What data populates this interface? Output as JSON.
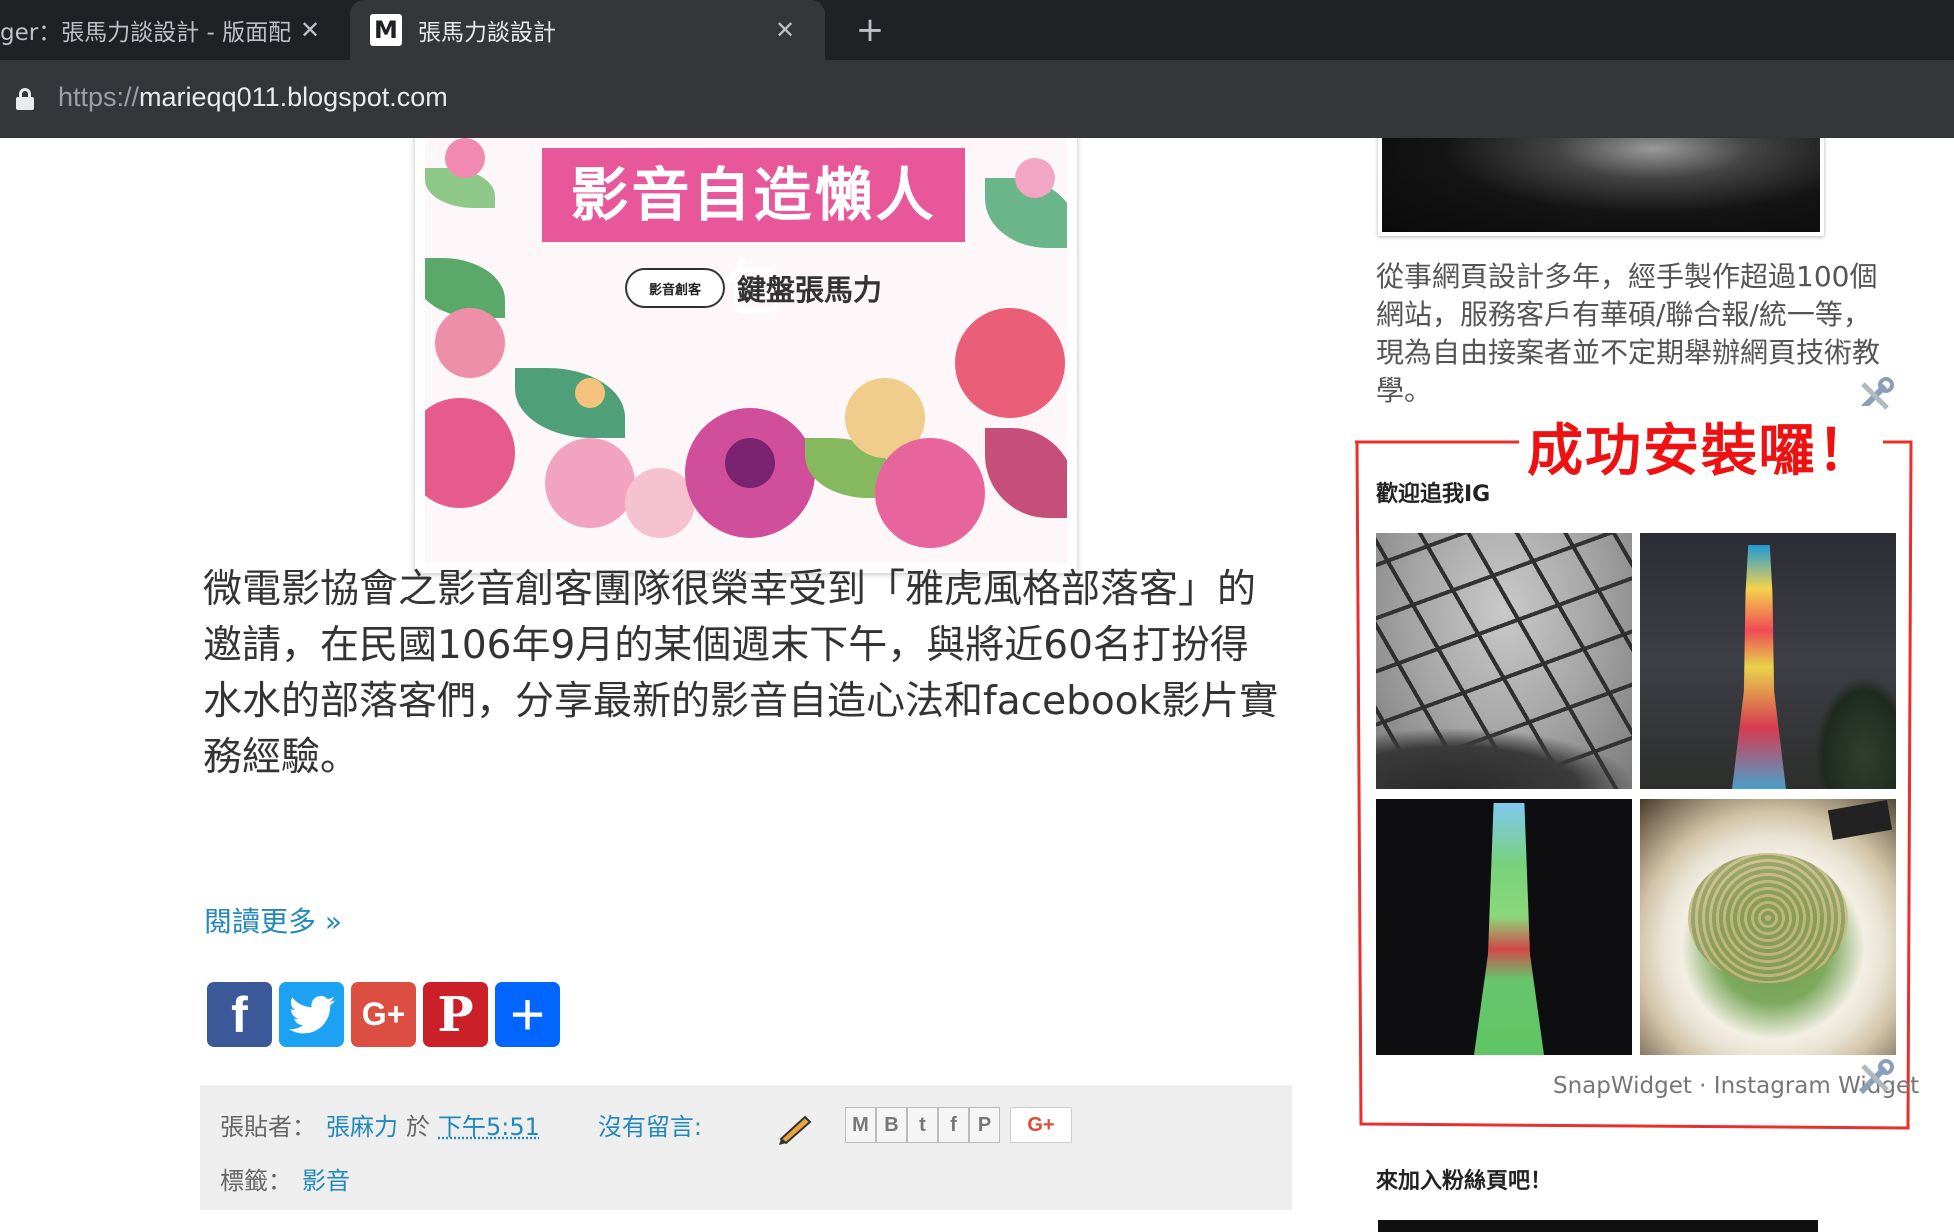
{
  "browser": {
    "tabs": [
      {
        "title": "ger：張馬力談設計 - 版面配",
        "active": false,
        "close": "✕"
      },
      {
        "title": "張馬力談設計",
        "favicon": "M",
        "active": true,
        "close": "✕"
      }
    ],
    "new_tab": "+",
    "url": {
      "scheme": "https://",
      "host": "marieqq011.blogspot.com"
    }
  },
  "post": {
    "banner": {
      "title": "影音自造懶人包",
      "logo_badge": "影音創客",
      "brand": "鍵盤張馬力"
    },
    "body": "微電影協會之影音創客團隊很榮幸受到「雅虎風格部落客」的邀請，在民國106年9月的某個週末下午，與將近60名打扮得水水的部落客們，分享最新的影音自造心法和facebook影片實務經驗。",
    "read_more": "閱讀更多 »",
    "share_buttons": [
      {
        "network": "facebook",
        "glyph": "f"
      },
      {
        "network": "twitter",
        "glyph": "🐦"
      },
      {
        "network": "google-plus",
        "glyph": "G+"
      },
      {
        "network": "pinterest",
        "glyph": "P"
      },
      {
        "network": "more",
        "glyph": "+"
      }
    ],
    "footer": {
      "posted_by_label": "張貼者：",
      "author": "張麻力",
      "at_label": "於",
      "time": "下午5:51",
      "comments": "沒有留言:",
      "labels_label": "標籤：",
      "label": "影音",
      "mini_shares": [
        "M",
        "B",
        "t",
        "f",
        "P"
      ],
      "gplus": "G+"
    }
  },
  "sidebar": {
    "about": "從事網頁設計多年，經手製作超過100個網站，服務客戶有華碩/聯合報/統一等，現為自由接案者並不定期舉辦網頁技術教學。",
    "annotation": "成功安裝囉！",
    "ig_widget": {
      "title": "歡迎追我IG",
      "credit": "SnapWidget · Instagram Widget"
    },
    "fans_title": "來加入粉絲頁吧！"
  }
}
